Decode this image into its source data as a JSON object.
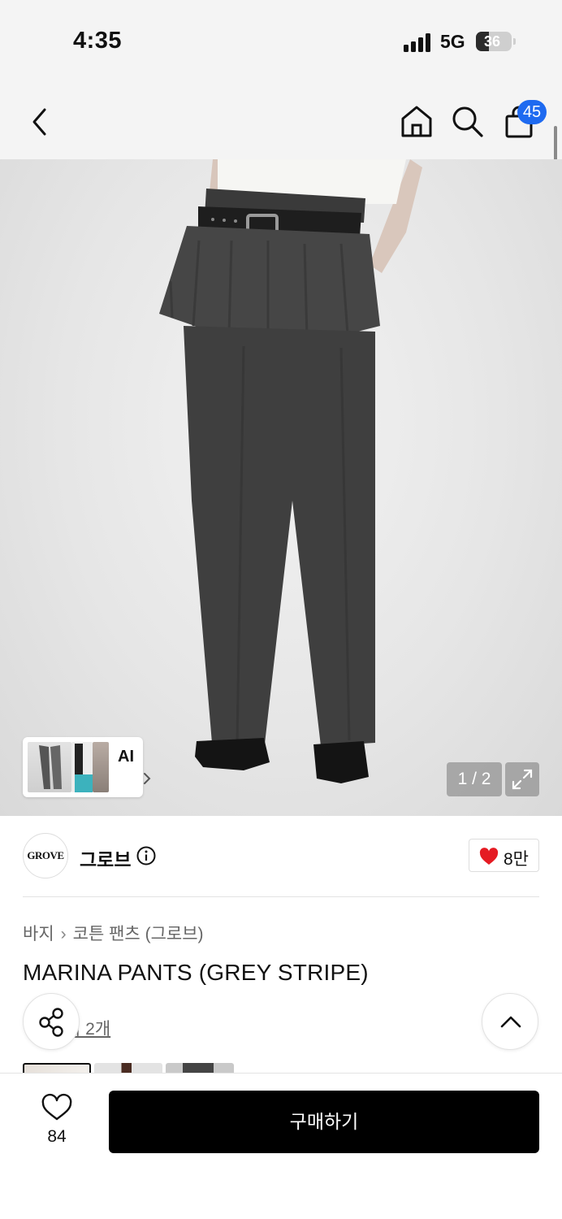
{
  "status_bar": {
    "time": "4:35",
    "network": "5G",
    "battery": "36",
    "battery_level": 0.36
  },
  "nav": {
    "back_icon": "chevron-left-icon",
    "home_icon": "home-icon",
    "search_icon": "search-icon",
    "cart_icon": "shopping-bag-icon",
    "cart_badge": "45"
  },
  "gallery": {
    "ai_label": "AI",
    "page_indicator": "1 / 2",
    "expand_icon": "expand-icon"
  },
  "brand": {
    "logo_text": "GROVE",
    "name": "그로브",
    "likes": "8만",
    "info_icon": "info-icon",
    "heart_color": "#e51b23"
  },
  "product": {
    "breadcrumb": [
      "바지",
      "코튼 팬츠 (그로브)"
    ],
    "title": "MARINA PANTS (GREY STRIPE)",
    "review_link": "기 2개"
  },
  "bottom_bar": {
    "wish_count": "84",
    "buy_label": "구매하기"
  },
  "colors": {
    "accent_badge": "#1e6af0",
    "buy_button": "#000000",
    "heart": "#e51b23"
  }
}
